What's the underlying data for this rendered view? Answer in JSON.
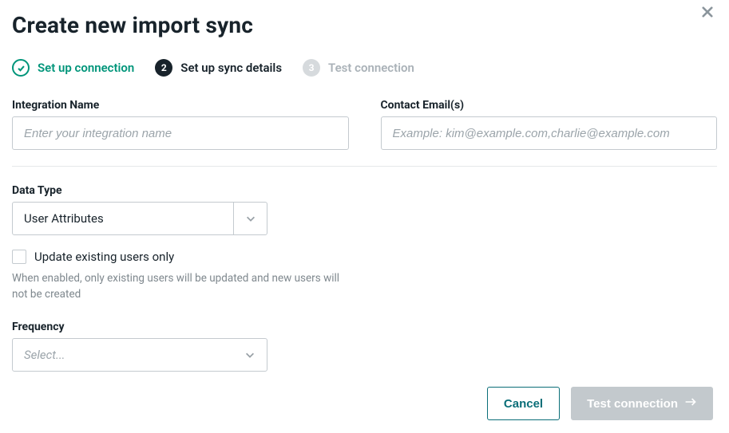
{
  "modal": {
    "title": "Create new import sync"
  },
  "stepper": {
    "step1": {
      "label": "Set up connection",
      "state": "complete"
    },
    "step2": {
      "number": "2",
      "label": "Set up sync details",
      "state": "active"
    },
    "step3": {
      "number": "3",
      "label": "Test connection",
      "state": "pending"
    }
  },
  "fields": {
    "integration_name": {
      "label": "Integration Name",
      "placeholder": "Enter your integration name",
      "value": ""
    },
    "contact_emails": {
      "label": "Contact Email(s)",
      "placeholder": "Example: kim@example.com,charlie@example.com",
      "value": ""
    },
    "data_type": {
      "label": "Data Type",
      "value": "User Attributes"
    },
    "update_existing": {
      "label": "Update existing users only",
      "checked": false,
      "help": "When enabled, only existing users will be updated and new users will not be created"
    },
    "frequency": {
      "label": "Frequency",
      "placeholder": "Select...",
      "value": ""
    }
  },
  "actions": {
    "cancel": "Cancel",
    "test_connection": "Test connection"
  }
}
